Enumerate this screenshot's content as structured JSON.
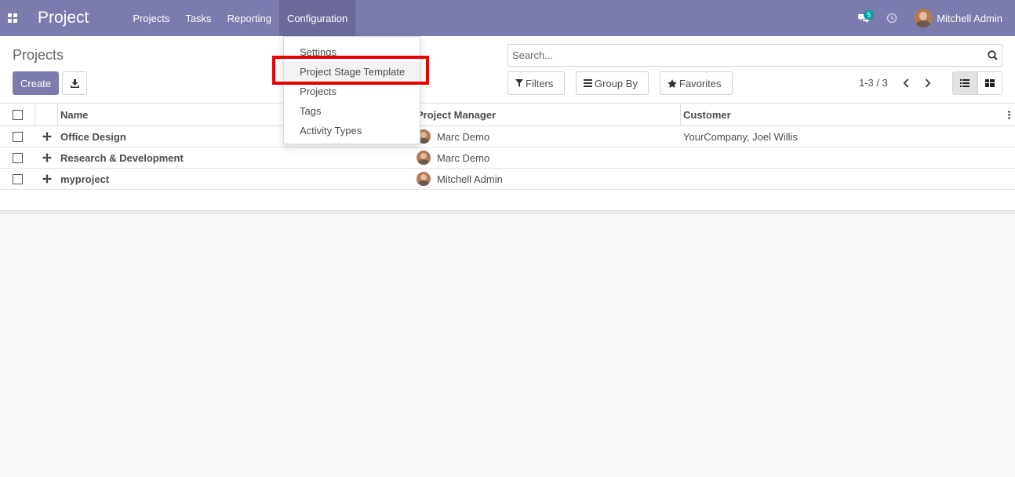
{
  "navbar": {
    "app_title": "Project",
    "menu": [
      "Projects",
      "Tasks",
      "Reporting",
      "Configuration"
    ],
    "active_menu": "Configuration",
    "chat_badge": "5",
    "user_name": "Mitchell Admin",
    "bg_color": "#7c7bad"
  },
  "control": {
    "breadcrumb": "Projects",
    "create_label": "Create",
    "search_placeholder": "Search...",
    "filters_label": "Filters",
    "groupby_label": "Group By",
    "favorites_label": "Favorites",
    "pager": "1-3 / 3"
  },
  "dropdown": {
    "items": [
      "Settings",
      "Project Stage Template",
      "Projects",
      "Tags",
      "Activity Types"
    ],
    "highlighted": "Project Stage Template"
  },
  "table": {
    "columns": [
      "Name",
      "Project Manager",
      "Customer"
    ],
    "rows": [
      {
        "name": "Office Design",
        "manager": "Marc Demo",
        "customer": "YourCompany, Joel Willis"
      },
      {
        "name": "Research & Development",
        "manager": "Marc Demo",
        "customer": ""
      },
      {
        "name": "myproject",
        "manager": "Mitchell Admin",
        "customer": ""
      }
    ]
  },
  "icons": [
    "apps-icon",
    "chat-icon",
    "clock-icon",
    "download-icon",
    "search-icon",
    "filter-icon",
    "groupby-icon",
    "star-icon",
    "chevron-left-icon",
    "chevron-right-icon",
    "list-view-icon",
    "kanban-view-icon",
    "drag-handle-icon",
    "kebab-icon"
  ]
}
